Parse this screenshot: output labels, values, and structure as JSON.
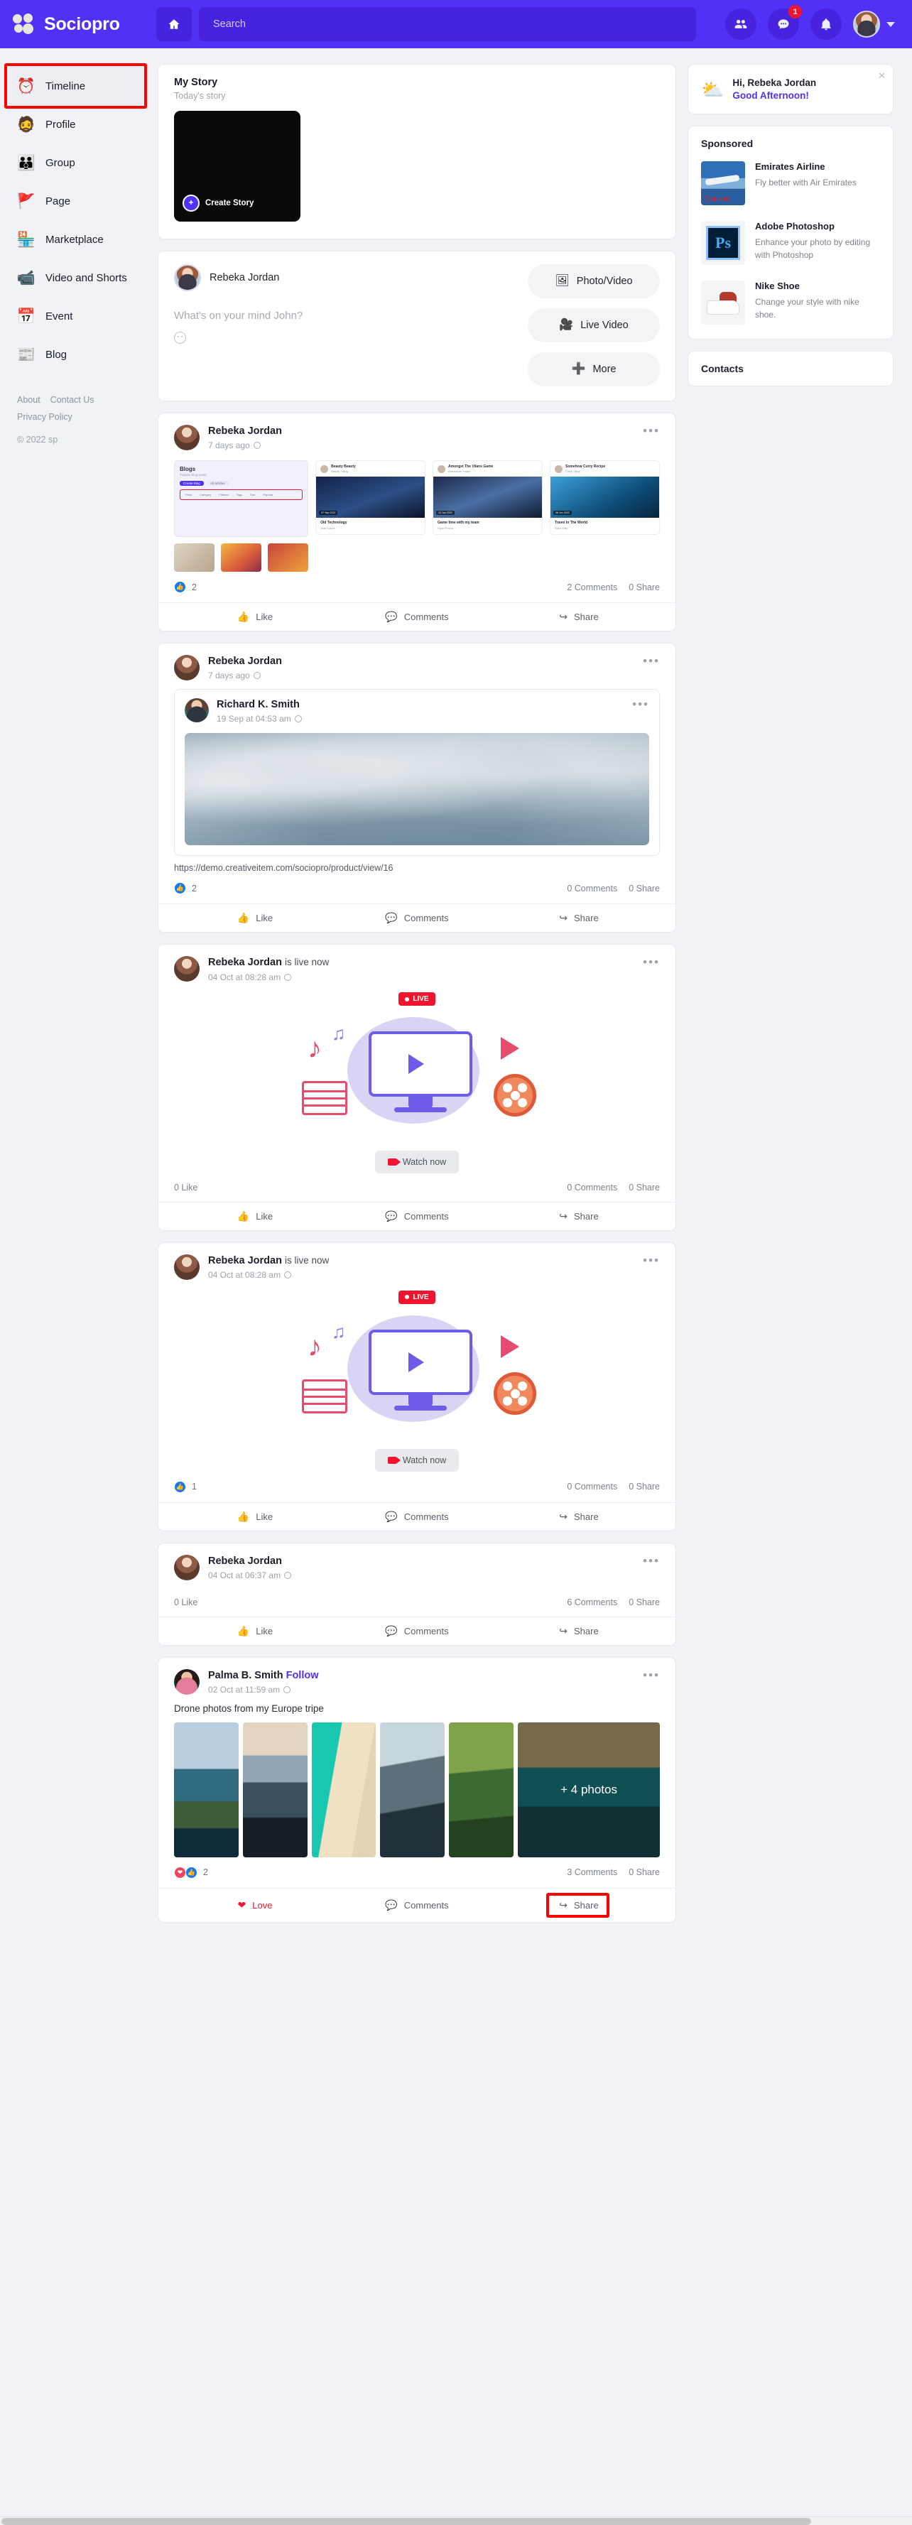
{
  "header": {
    "brand": "Sociopro",
    "home_icon": "home-icon",
    "search_placeholder": "Search",
    "search_value": "",
    "friends_icon": "friends-icon",
    "messages_icon": "messages-icon",
    "messages_badge": "1",
    "notifications_icon": "bell-icon",
    "avatar_label": "user-avatar",
    "caret_icon": "chevron-down-icon"
  },
  "sidebar": {
    "items": [
      {
        "label": "Timeline",
        "icon": "⏰",
        "active": true,
        "highlighted": true
      },
      {
        "label": "Profile",
        "icon": "🧔",
        "active": false,
        "highlighted": false
      },
      {
        "label": "Group",
        "icon": "👨‍👩‍👧",
        "active": false,
        "highlighted": false
      },
      {
        "label": "Page",
        "icon": "🚩",
        "active": false,
        "highlighted": false
      },
      {
        "label": "Marketplace",
        "icon": "🏪",
        "active": false,
        "highlighted": false
      },
      {
        "label": "Video and Shorts",
        "icon": "📹",
        "active": false,
        "highlighted": false
      },
      {
        "label": "Event",
        "icon": "📅",
        "active": false,
        "highlighted": false
      },
      {
        "label": "Blog",
        "icon": "📰",
        "active": false,
        "highlighted": false
      }
    ],
    "links": [
      "About",
      "Contact Us",
      "Privacy Policy"
    ],
    "copyright": "© 2022 sp"
  },
  "story": {
    "title": "My Story",
    "subtitle": "Today's story",
    "create_label": "Create Story",
    "plus_icon": "plus-icon"
  },
  "composer": {
    "user": "Rebeka Jordan",
    "placeholder": "What's on your mind John?",
    "emoji_icon": "smiley-icon",
    "buttons": [
      {
        "label": "Photo/Video",
        "icon": "🖼"
      },
      {
        "label": "Live Video",
        "icon": "🎥"
      },
      {
        "label": "More",
        "icon": "➕"
      }
    ]
  },
  "posts": [
    {
      "id": "post-blog-grid",
      "author": "Rebeka Jordan",
      "time": "7 days ago",
      "privacy_icon": "globe-icon",
      "menu_icon": "more-dots-icon",
      "reactions": {
        "types": [
          "like"
        ],
        "count": "2"
      },
      "comments": "2 Comments",
      "shares": "0 Share",
      "actions": [
        {
          "label": "Like",
          "icon": "👍",
          "state": "off"
        },
        {
          "label": "Comments",
          "icon": "💬",
          "state": "off"
        },
        {
          "label": "Share",
          "icon": "↪",
          "state": "off"
        }
      ],
      "blog_preview": {
        "title": "Blogs",
        "subtitle": "Popular blog posts",
        "pill_primary": "Create Blog",
        "pill_secondary": "All articles",
        "chips": [
          "Price",
          "Category",
          "Filtered",
          "Tags",
          "Sort",
          "Popular",
          "Recent"
        ]
      },
      "video_cards": [
        {
          "author": "Beauty Beauty",
          "meta": "Beauty / Blog",
          "tag": "07 Sep 2022",
          "title": "Old Technology",
          "date": "Jeani Lopez"
        },
        {
          "author": "Amongst The Vilans Game",
          "meta": "Announcer Trailer",
          "tag": "13 Jun 2022",
          "title": "Game time with my team",
          "date": "Riyah Emma"
        },
        {
          "author": "Somehow Curry Recipe",
          "meta": "Food / Blog",
          "tag": "08 Jun 2022",
          "title": "Travel In The World",
          "date": "Hana Wills"
        }
      ]
    },
    {
      "id": "post-shared-link",
      "author": "Rebeka Jordan",
      "time": "7 days ago",
      "privacy_icon": "globe-icon",
      "menu_icon": "more-dots-icon",
      "shared": {
        "author": "Richard K. Smith",
        "time": "19 Sep at 04:53 am",
        "privacy_icon": "globe-icon",
        "menu_icon": "more-dots-icon"
      },
      "link": "https://demo.creativeitem.com/sociopro/product/view/16",
      "reactions": {
        "types": [
          "like"
        ],
        "count": "2"
      },
      "comments": "0 Comments",
      "shares": "0 Share",
      "actions": [
        {
          "label": "Like",
          "icon": "👍",
          "state": "off"
        },
        {
          "label": "Comments",
          "icon": "💬",
          "state": "off"
        },
        {
          "label": "Share",
          "icon": "↪",
          "state": "off"
        }
      ]
    },
    {
      "id": "post-live-1",
      "author": "Rebeka Jordan",
      "author_suffix": "is live now",
      "time": "04 Oct at 08:28 am",
      "privacy_icon": "globe-icon",
      "menu_icon": "more-dots-icon",
      "live_label": "LIVE",
      "watch_label": "Watch now",
      "like_summary": "0 Like",
      "comments": "0 Comments",
      "shares": "0 Share",
      "actions": [
        {
          "label": "Like",
          "icon": "👍",
          "state": "off"
        },
        {
          "label": "Comments",
          "icon": "💬",
          "state": "off"
        },
        {
          "label": "Share",
          "icon": "↪",
          "state": "off"
        }
      ]
    },
    {
      "id": "post-live-2",
      "author": "Rebeka Jordan",
      "author_suffix": "is live now",
      "time": "04 Oct at 08:28 am",
      "privacy_icon": "globe-icon",
      "menu_icon": "more-dots-icon",
      "live_label": "LIVE",
      "watch_label": "Watch now",
      "reactions": {
        "types": [
          "like"
        ],
        "count": "1"
      },
      "comments": "0 Comments",
      "shares": "0 Share",
      "actions": [
        {
          "label": "Like",
          "icon": "👍",
          "state": "off"
        },
        {
          "label": "Comments",
          "icon": "💬",
          "state": "off"
        },
        {
          "label": "Share",
          "icon": "↪",
          "state": "off"
        }
      ]
    },
    {
      "id": "post-text-only",
      "author": "Rebeka Jordan",
      "time": "04 Oct at 06:37 am",
      "privacy_icon": "globe-icon",
      "menu_icon": "more-dots-icon",
      "like_summary": "0 Like",
      "comments": "6 Comments",
      "shares": "0 Share",
      "actions": [
        {
          "label": "Like",
          "icon": "👍",
          "state": "off"
        },
        {
          "label": "Comments",
          "icon": "💬",
          "state": "off"
        },
        {
          "label": "Share",
          "icon": "↪",
          "state": "off"
        }
      ]
    },
    {
      "id": "post-photos",
      "author": "Palma B. Smith",
      "follow_label": "Follow",
      "time": "02 Oct at 11:59 am",
      "privacy_icon": "globe-icon",
      "menu_icon": "more-dots-icon",
      "text": "Drone photos from my Europe tripe",
      "more_photos": "+ 4 photos",
      "reactions": {
        "types": [
          "love",
          "like"
        ],
        "count": "2"
      },
      "comments": "3 Comments",
      "shares": "0 Share",
      "actions": [
        {
          "label": "Love",
          "icon": "❤",
          "state": "on"
        },
        {
          "label": "Comments",
          "icon": "💬",
          "state": "off"
        },
        {
          "label": "Share",
          "icon": "↪",
          "state": "off",
          "highlighted": true
        }
      ]
    }
  ],
  "rightbar": {
    "greeting_name": "Hi, Rebeka Jordan",
    "greeting_message": "Good Afternoon!",
    "greeting_icon": "sun-cloud-icon",
    "close_icon": "close-icon",
    "sponsored_title": "Sponsored",
    "ads": [
      {
        "title": "Emirates Airline",
        "desc": "Fly better with Air Emirates"
      },
      {
        "title": "Adobe Photoshop",
        "desc": "Enhance your photo by editing with Photoshop"
      },
      {
        "title": "Nike Shoe",
        "desc": "Change your style with nike shoe."
      }
    ],
    "contacts_title": "Contacts"
  },
  "colors": {
    "brand": "#5131f5",
    "brand_dark": "#4723e0",
    "highlight": "#ff0000",
    "like": "#1877f2",
    "love": "#f3425f"
  }
}
